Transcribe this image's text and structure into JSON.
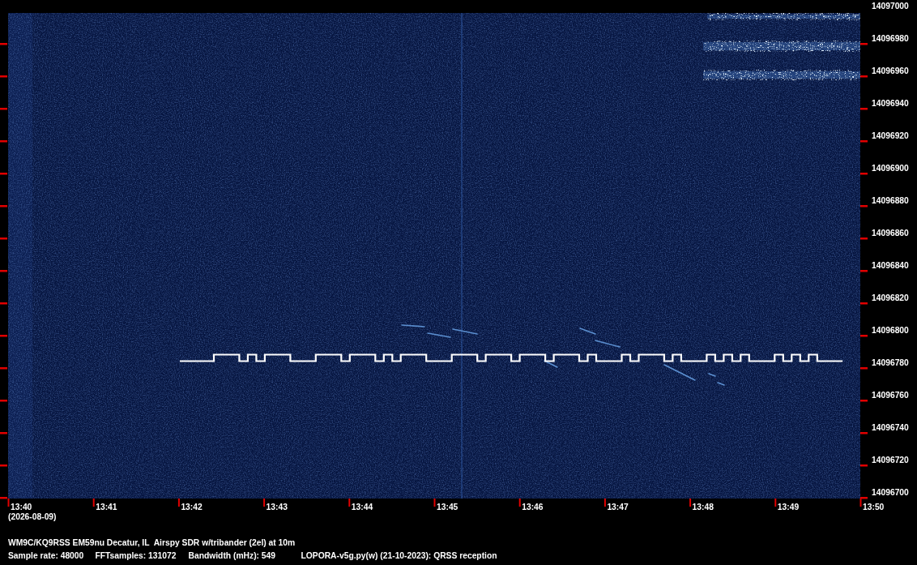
{
  "spectrogram": {
    "frequency_axis": {
      "labels": [
        "14097000",
        "14096980",
        "14096960",
        "14096940",
        "14096920",
        "14096900",
        "14096880",
        "14096860",
        "14096840",
        "14096820",
        "14096800",
        "14096780",
        "14096760",
        "14096740",
        "14096720",
        "14096700"
      ]
    },
    "time_axis": {
      "labels": [
        "13:40",
        "13:41",
        "13:42",
        "13:43",
        "13:44",
        "13:45",
        "13:46",
        "13:47",
        "13:48",
        "13:49",
        "13:50"
      ],
      "date": "(2026-08-09)"
    }
  },
  "footer": {
    "station": "WM9C/KQ9RSS EM59nu Decatur, IL  Airspy SDR w/tribander (2el) at 10m",
    "parameters": [
      "Sample rate: 48000",
      "FFTsamples: 131072",
      "Bandwidth (mHz): 549",
      "LOPORA-v5g.py(w) (21-10-2023): QRSS reception"
    ]
  }
}
